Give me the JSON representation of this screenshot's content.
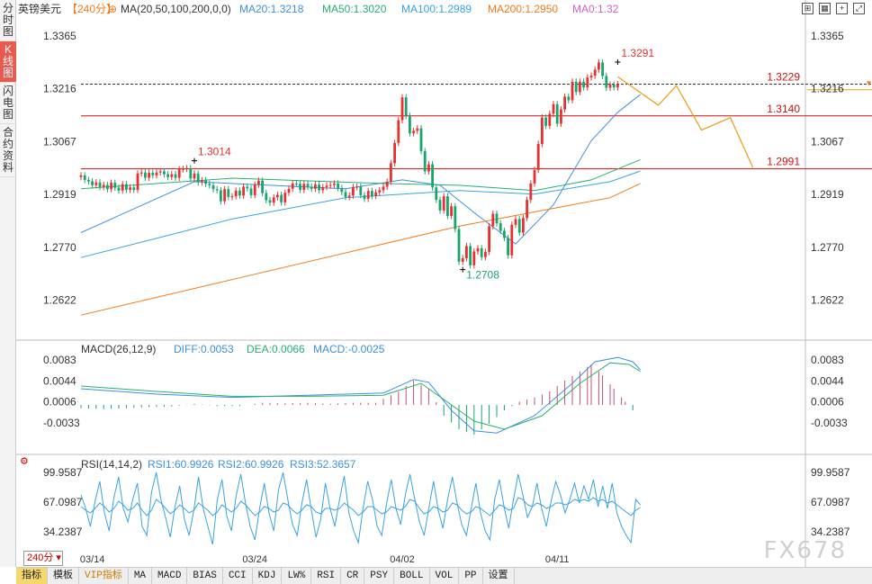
{
  "left_tabs": [
    {
      "label": "分\n时\n图",
      "active": false
    },
    {
      "label": "K\n线\n图",
      "active": true
    },
    {
      "label": "闪\n电\n图",
      "active": false
    },
    {
      "label": "合\n约\n资\n料",
      "active": false
    }
  ],
  "header": {
    "symbol": "英镑美元",
    "period": "【240分】",
    "ma_label": "MA(20,50,100,200,0,0)",
    "ma20": "MA20:1.3218",
    "ma50": "MA50:1.3020",
    "ma100": "MA100:1.2989",
    "ma200": "MA200:1.2950",
    "ma0": "MA0:1.32"
  },
  "macd_header": {
    "name": "MACD(26,12,9)",
    "diff": "DIFF:0.0053",
    "dea": "DEA:0.0066",
    "macd": "MACD:-0.0025"
  },
  "rsi_header": {
    "name": "RSI(14,14,2)",
    "rsi1": "RSI1:60.9926",
    "rsi2": "RSI2:60.9926",
    "rsi3": "RSI3:52.3657"
  },
  "bottom_tabs": [
    "指标",
    "模板",
    "VIP指标",
    "MA",
    "MACD",
    "BIAS",
    "CCI",
    "KDJ",
    "LW%",
    "RSI",
    "CR",
    "PSY",
    "BOLL",
    "VOL",
    "PP",
    "设置"
  ],
  "period_selector": "240分",
  "watermark": "FX678",
  "colors": {
    "up": "#e8302f",
    "down": "#19a36d",
    "ma20": "#3d8fe0",
    "ma50": "#27b06f",
    "ma100": "#3aa3e0",
    "ma200": "#f07a18",
    "forecast": "#f09a1a",
    "level": "#d01010"
  },
  "chart_data": {
    "type": "candlestick",
    "price_axis": {
      "ticks": [
        1.3365,
        1.3216,
        1.3067,
        1.2919,
        1.277,
        1.2622
      ],
      "ylim": [
        1.253,
        1.3415
      ]
    },
    "date_labels": [
      {
        "label": "03/14",
        "index": 3
      },
      {
        "label": "03/24",
        "index": 46
      },
      {
        "label": "04/02",
        "index": 85
      },
      {
        "label": "04/11",
        "index": 126
      }
    ],
    "candles": [
      [
        1.2968,
        1.2973
      ],
      [
        1.2973,
        1.296
      ],
      [
        1.296,
        1.2956
      ],
      [
        1.2956,
        1.2945
      ],
      [
        1.2945,
        1.2953
      ],
      [
        1.2953,
        1.294
      ],
      [
        1.294,
        1.2946
      ],
      [
        1.2946,
        1.2934
      ],
      [
        1.2934,
        1.2952
      ],
      [
        1.2952,
        1.2938
      ],
      [
        1.2938,
        1.293
      ],
      [
        1.293,
        1.2948
      ],
      [
        1.2948,
        1.2932
      ],
      [
        1.2932,
        1.2939
      ],
      [
        1.2939,
        1.2932
      ],
      [
        1.2932,
        1.2978
      ],
      [
        1.2978,
        1.2981
      ],
      [
        1.2981,
        1.2966
      ],
      [
        1.2966,
        1.298
      ],
      [
        1.298,
        1.2973
      ],
      [
        1.2973,
        1.2981
      ],
      [
        1.2981,
        1.2984
      ],
      [
        1.2984,
        1.2976
      ],
      [
        1.2976,
        1.2968
      ],
      [
        1.2968,
        1.2976
      ],
      [
        1.2976,
        1.2966
      ],
      [
        1.2966,
        1.299
      ],
      [
        1.299,
        1.2991
      ],
      [
        1.2991,
        1.2993
      ],
      [
        1.2993,
        1.2964
      ],
      [
        1.2964,
        1.2978
      ],
      [
        1.2978,
        1.2953
      ],
      [
        1.2953,
        1.2959
      ],
      [
        1.2959,
        1.2949
      ],
      [
        1.2949,
        1.2945
      ],
      [
        1.2945,
        1.2934
      ],
      [
        1.2934,
        1.2931
      ],
      [
        1.2931,
        1.29
      ],
      [
        1.29,
        1.2934
      ],
      [
        1.2934,
        1.2912
      ],
      [
        1.2912,
        1.2914
      ],
      [
        1.2914,
        1.293
      ],
      [
        1.293,
        1.2916
      ],
      [
        1.2916,
        1.2941
      ],
      [
        1.2941,
        1.2936
      ],
      [
        1.2936,
        1.2917
      ],
      [
        1.2917,
        1.2947
      ],
      [
        1.2947,
        1.2958
      ],
      [
        1.2958,
        1.2923
      ],
      [
        1.2923,
        1.2903
      ],
      [
        1.2903,
        1.2896
      ],
      [
        1.2896,
        1.2911
      ],
      [
        1.2911,
        1.2918
      ],
      [
        1.2918,
        1.2897
      ],
      [
        1.2897,
        1.2924
      ],
      [
        1.2924,
        1.2935
      ],
      [
        1.2935,
        1.295
      ],
      [
        1.295,
        1.2949
      ],
      [
        1.2949,
        1.2932
      ],
      [
        1.2932,
        1.2949
      ],
      [
        1.2949,
        1.2941
      ],
      [
        1.2941,
        1.2935
      ],
      [
        1.2935,
        1.2947
      ],
      [
        1.2947,
        1.2931
      ],
      [
        1.2931,
        1.294
      ],
      [
        1.294,
        1.2944
      ],
      [
        1.2944,
        1.2946
      ],
      [
        1.2946,
        1.295
      ],
      [
        1.295,
        1.2937
      ],
      [
        1.2937,
        1.2926
      ],
      [
        1.2926,
        1.2912
      ],
      [
        1.2912,
        1.2916
      ],
      [
        1.2916,
        1.294
      ],
      [
        1.294,
        1.2941
      ],
      [
        1.2941,
        1.2917
      ],
      [
        1.2917,
        1.2907
      ],
      [
        1.2907,
        1.2929
      ],
      [
        1.2929,
        1.2915
      ],
      [
        1.2915,
        1.2925
      ],
      [
        1.2925,
        1.2931
      ],
      [
        1.2931,
        1.2941
      ],
      [
        1.2941,
        1.2955
      ],
      [
        1.2955,
        1.3007
      ],
      [
        1.3007,
        1.3064
      ],
      [
        1.3064,
        1.3128
      ],
      [
        1.3128,
        1.3192
      ],
      [
        1.3192,
        1.314
      ],
      [
        1.314,
        1.3091
      ],
      [
        1.3091,
        1.3098
      ],
      [
        1.3098,
        1.3105
      ],
      [
        1.3105,
        1.3041
      ],
      [
        1.3041,
        1.2984
      ],
      [
        1.2984,
        1.3004
      ],
      [
        1.3004,
        1.2939
      ],
      [
        1.2939,
        1.2904
      ],
      [
        1.2904,
        1.2874
      ],
      [
        1.2874,
        1.2914
      ],
      [
        1.2914,
        1.2859
      ],
      [
        1.2859,
        1.2886
      ],
      [
        1.2886,
        1.2822
      ],
      [
        1.2822,
        1.273
      ],
      [
        1.273,
        1.274
      ],
      [
        1.274,
        1.2774
      ],
      [
        1.2774,
        1.272
      ],
      [
        1.272,
        1.2759
      ],
      [
        1.2759,
        1.2768
      ],
      [
        1.2768,
        1.2743
      ],
      [
        1.2743,
        1.2758
      ],
      [
        1.2758,
        1.283
      ],
      [
        1.283,
        1.2865
      ],
      [
        1.2865,
        1.2838
      ],
      [
        1.2838,
        1.2817
      ],
      [
        1.2817,
        1.2797
      ],
      [
        1.2797,
        1.2748
      ],
      [
        1.2748,
        1.2834
      ],
      [
        1.2834,
        1.285
      ],
      [
        1.285,
        1.2812
      ],
      [
        1.2812,
        1.2853
      ],
      [
        1.2853,
        1.2904
      ],
      [
        1.2904,
        1.295
      ],
      [
        1.295,
        1.2988
      ],
      [
        1.2988,
        1.3061
      ],
      [
        1.3061,
        1.3135
      ],
      [
        1.3135,
        1.3112
      ],
      [
        1.3112,
        1.3146
      ],
      [
        1.3146,
        1.3173
      ],
      [
        1.3173,
        1.3118
      ],
      [
        1.3118,
        1.3158
      ],
      [
        1.3158,
        1.3194
      ],
      [
        1.3194,
        1.3184
      ],
      [
        1.3184,
        1.3236
      ],
      [
        1.3236,
        1.3207
      ],
      [
        1.3207,
        1.3236
      ],
      [
        1.3236,
        1.322
      ],
      [
        1.322,
        1.3248
      ],
      [
        1.3248,
        1.3253
      ],
      [
        1.3253,
        1.327
      ],
      [
        1.327,
        1.329
      ],
      [
        1.329,
        1.3252
      ],
      [
        1.3252,
        1.3219
      ],
      [
        1.3219,
        1.3228
      ],
      [
        1.3228,
        1.322
      ],
      [
        1.322,
        1.3229
      ]
    ],
    "annotations": [
      {
        "label": "1.3291",
        "value": 1.3291,
        "index": 142
      },
      {
        "label": "1.3014",
        "value": 1.3014,
        "index": 30
      },
      {
        "label": "1.2708",
        "value": 1.2708,
        "index": 101
      }
    ],
    "levels": [
      {
        "label": "1.3229",
        "value": 1.3229,
        "style": "dashed"
      },
      {
        "label": "1.3140",
        "value": 1.314,
        "style": "solid"
      },
      {
        "label": "1.2991",
        "value": 1.2991,
        "style": "solid"
      }
    ],
    "forecast_path": [
      1.325,
      1.317,
      1.3225,
      1.31,
      1.3135,
      1.2995
    ],
    "ma_lines": [
      {
        "name": "MA20",
        "points": [
          [
            0,
            1.2812
          ],
          [
            30,
            1.2955
          ],
          [
            50,
            1.2945
          ],
          [
            70,
            1.2935
          ],
          [
            85,
            1.296
          ],
          [
            95,
            1.2945
          ],
          [
            105,
            1.286
          ],
          [
            115,
            1.278
          ],
          [
            125,
            1.289
          ],
          [
            135,
            1.307
          ],
          [
            142,
            1.315
          ],
          [
            148,
            1.32
          ]
        ]
      },
      {
        "name": "MA50",
        "points": [
          [
            0,
            1.2935
          ],
          [
            40,
            1.2965
          ],
          [
            80,
            1.295
          ],
          [
            100,
            1.2945
          ],
          [
            120,
            1.293
          ],
          [
            135,
            1.296
          ],
          [
            148,
            1.3017
          ]
        ]
      },
      {
        "name": "MA100",
        "points": [
          [
            0,
            1.2742
          ],
          [
            40,
            1.285
          ],
          [
            70,
            1.291
          ],
          [
            100,
            1.293
          ],
          [
            120,
            1.292
          ],
          [
            140,
            1.2955
          ],
          [
            148,
            1.2985
          ]
        ]
      },
      {
        "name": "MA200",
        "points": [
          [
            0,
            1.258
          ],
          [
            40,
            1.268
          ],
          [
            80,
            1.278
          ],
          [
            100,
            1.283
          ],
          [
            120,
            1.287
          ],
          [
            140,
            1.291
          ],
          [
            148,
            1.295
          ]
        ]
      }
    ],
    "macd": {
      "ticks": [
        0.0083,
        0.0044,
        0.0006,
        -0.0033
      ],
      "ylim": [
        -0.0075,
        0.01
      ],
      "diff": [
        [
          0,
          0.003
        ],
        [
          20,
          0.002
        ],
        [
          40,
          0.0014
        ],
        [
          60,
          0.0018
        ],
        [
          80,
          0.0022
        ],
        [
          88,
          0.0047
        ],
        [
          92,
          0.0042
        ],
        [
          98,
          -0.001
        ],
        [
          104,
          -0.0048
        ],
        [
          110,
          -0.0052
        ],
        [
          120,
          -0.002
        ],
        [
          130,
          0.004
        ],
        [
          136,
          0.008
        ],
        [
          142,
          0.0088
        ],
        [
          146,
          0.008
        ],
        [
          148,
          0.0065
        ]
      ],
      "dea": [
        [
          0,
          0.0035
        ],
        [
          20,
          0.0025
        ],
        [
          40,
          0.0016
        ],
        [
          60,
          0.0016
        ],
        [
          80,
          0.0018
        ],
        [
          90,
          0.004
        ],
        [
          96,
          0.001
        ],
        [
          104,
          -0.003
        ],
        [
          112,
          -0.0045
        ],
        [
          122,
          -0.002
        ],
        [
          132,
          0.004
        ],
        [
          140,
          0.0078
        ],
        [
          145,
          0.0075
        ],
        [
          148,
          0.0062
        ]
      ],
      "hist": [
        [
          0,
          -0.0006
        ],
        [
          6,
          -0.0008
        ],
        [
          12,
          -0.0006
        ],
        [
          18,
          -0.0004
        ],
        [
          24,
          -0.0003
        ],
        [
          30,
          0.0002
        ],
        [
          36,
          -0.0002
        ],
        [
          42,
          -0.0002
        ],
        [
          48,
          0.0004
        ],
        [
          54,
          0.0003
        ],
        [
          60,
          0.0004
        ],
        [
          66,
          0.0002
        ],
        [
          72,
          0.0004
        ],
        [
          78,
          0.0004
        ],
        [
          84,
          0.0025
        ],
        [
          88,
          0.0045
        ],
        [
          92,
          0.003
        ],
        [
          96,
          -0.002
        ],
        [
          100,
          -0.0045
        ],
        [
          104,
          -0.0055
        ],
        [
          108,
          -0.0035
        ],
        [
          112,
          -0.001
        ],
        [
          116,
          0.0006
        ],
        [
          120,
          0.0014
        ],
        [
          124,
          0.0025
        ],
        [
          128,
          0.0045
        ],
        [
          132,
          0.0062
        ],
        [
          135,
          0.0075
        ],
        [
          138,
          0.0055
        ],
        [
          141,
          0.003
        ],
        [
          144,
          0.0006
        ],
        [
          146,
          -0.001
        ],
        [
          148,
          -0.0025
        ]
      ]
    },
    "rsi": {
      "ticks": [
        99.9587,
        67.0987,
        34.2387
      ],
      "ylim": [
        15,
        110
      ],
      "rsi1": [
        75,
        60,
        40,
        68,
        90,
        55,
        35,
        72,
        95,
        60,
        45,
        70,
        88,
        40,
        30,
        78,
        100,
        70,
        50,
        28,
        62,
        85,
        48,
        30,
        58,
        95,
        60,
        40,
        20,
        70,
        92,
        52,
        35,
        74,
        98,
        66,
        40,
        25,
        60,
        88,
        55,
        35,
        80,
        100,
        70,
        42,
        30,
        66,
        92,
        58,
        28,
        48,
        88,
        60,
        40,
        70,
        96,
        55,
        35,
        22,
        60,
        90,
        70,
        40,
        30,
        65,
        92,
        60,
        42,
        75,
        98,
        70,
        45,
        30,
        60,
        90,
        58,
        38,
        70,
        95,
        66,
        42,
        30,
        60,
        88,
        55,
        35,
        25,
        70,
        92,
        62,
        38,
        70,
        98,
        75,
        50,
        62,
        88,
        60,
        40,
        68,
        90,
        75,
        55,
        70,
        88,
        66,
        85,
        70,
        92,
        62,
        85,
        60,
        88,
        55,
        40,
        30,
        22,
        70,
        64
      ],
      "rsi2": [
        62,
        58,
        55,
        60,
        66,
        62,
        56,
        60,
        68,
        64,
        58,
        60,
        66,
        58,
        52,
        58,
        70,
        66,
        60,
        54,
        58,
        64,
        60,
        55,
        58,
        66,
        62,
        58,
        52,
        56,
        64,
        60,
        56,
        60,
        68,
        64,
        58,
        52,
        56,
        62,
        60,
        56,
        58,
        66,
        64,
        58,
        54,
        58,
        64,
        62,
        56,
        54,
        60,
        60,
        58,
        60,
        66,
        62,
        58,
        52,
        56,
        62,
        62,
        58,
        54,
        56,
        62,
        60,
        58,
        62,
        70,
        68,
        60,
        54,
        56,
        62,
        60,
        56,
        58,
        66,
        64,
        58,
        54,
        56,
        62,
        60,
        56,
        52,
        58,
        64,
        62,
        58,
        60,
        72,
        70,
        64,
        62,
        66,
        64,
        60,
        62,
        66,
        66,
        64,
        66,
        70,
        68,
        70,
        68,
        72,
        68,
        70,
        66,
        68,
        64,
        60,
        56,
        52,
        58,
        61
      ]
    }
  }
}
